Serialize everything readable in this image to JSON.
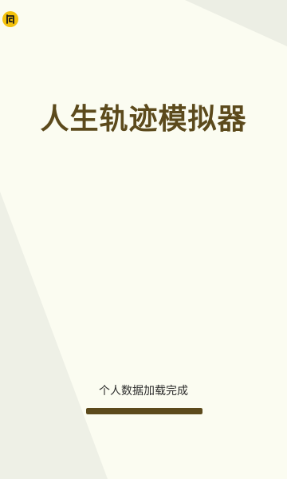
{
  "app": {
    "title": "人生轨迹模拟器",
    "badge_icon": "app-logo-icon",
    "badge_color": "#f4c20d"
  },
  "loading": {
    "status_text": "个人数据加载完成",
    "progress": 1.0
  },
  "colors": {
    "background": "#fbfcf1",
    "accent": "#5c4a1c",
    "shape": "#eef0e6"
  }
}
